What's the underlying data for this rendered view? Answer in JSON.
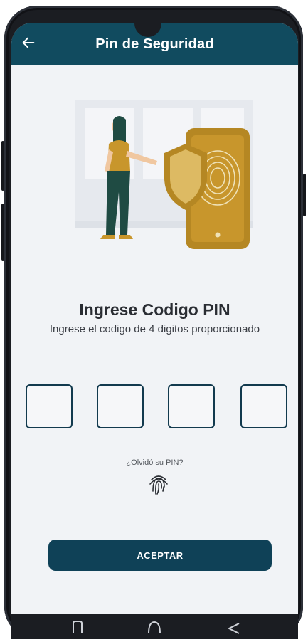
{
  "header": {
    "title": "Pin de Seguridad",
    "back_icon": "arrow-left-icon",
    "color": "#114b5f"
  },
  "content": {
    "title": "Ingrese Codigo PIN",
    "subtitle": "Ingrese el codigo de 4 digitos proporcionado",
    "pin_length": 4,
    "pin_values": [
      "",
      "",
      "",
      ""
    ],
    "forgot_link": "¿Olvidó su PIN?",
    "fingerprint_icon": "fingerprint-icon",
    "accept_button": "ACEPTAR"
  },
  "nav": {
    "items": [
      "recent-apps-icon",
      "home-icon",
      "back-triangle-icon"
    ]
  },
  "colors": {
    "primary": "#0f4157",
    "accent_gold": "#c8962c",
    "figure_green": "#1f4b43",
    "background": "#f1f3f6"
  }
}
